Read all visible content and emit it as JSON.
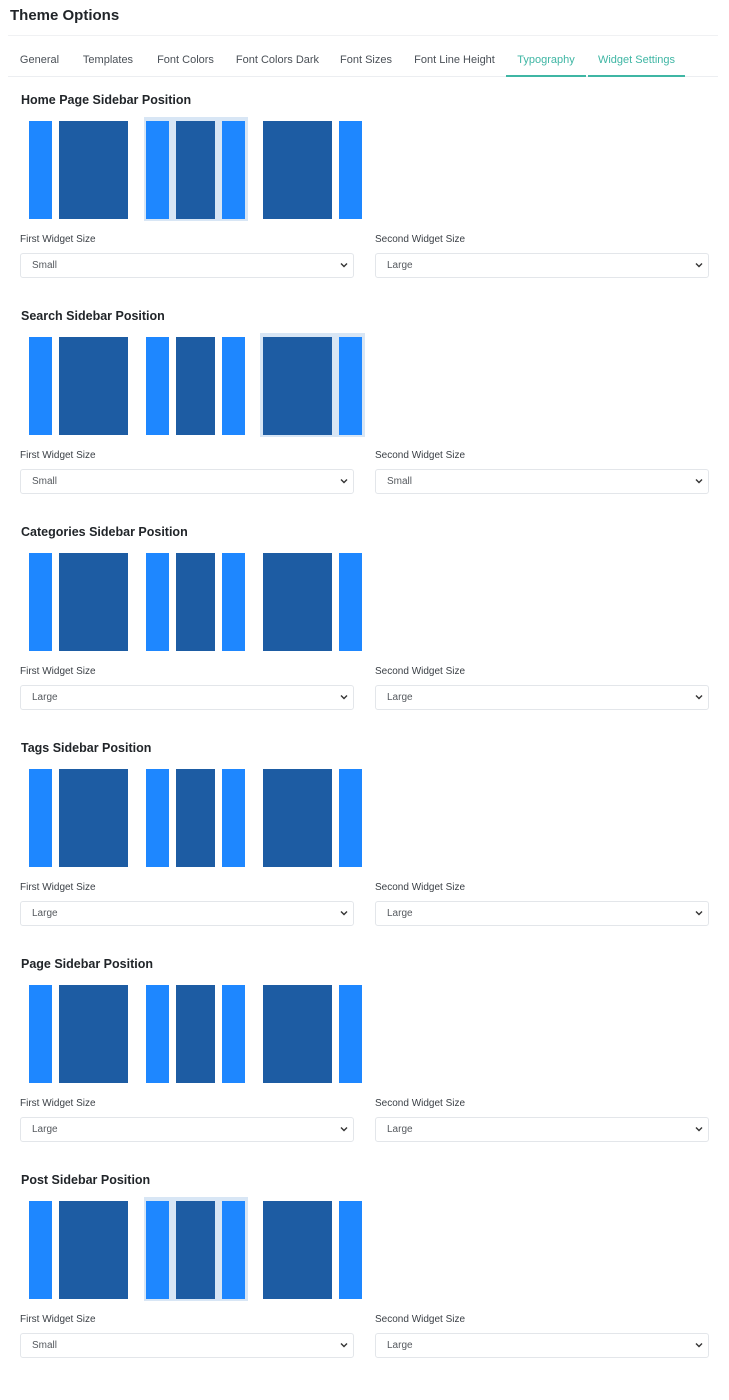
{
  "header": {
    "title": "Theme Options"
  },
  "tabs": [
    {
      "label": "General",
      "active": false
    },
    {
      "label": "Templates",
      "active": false
    },
    {
      "label": "Font Colors",
      "active": false
    },
    {
      "label": "Font Colors Dark",
      "active": false
    },
    {
      "label": "Font Sizes",
      "active": false
    },
    {
      "label": "Font Line Height",
      "active": false
    },
    {
      "label": "Typography",
      "active": true
    },
    {
      "label": "Widget Settings",
      "active": true
    }
  ],
  "colors": {
    "accent_tab": "#3fb6a4",
    "sidebar_block": "#1e87ff",
    "content_block": "#1d5ca3",
    "selected_bg": "#d8e6f5"
  },
  "sections": [
    {
      "title": "Home Page Sidebar Position",
      "selected": "both",
      "first_label": "First Widget Size",
      "first_value": "Small",
      "second_label": "Second Widget Size",
      "second_value": "Large"
    },
    {
      "title": "Search Sidebar Position",
      "selected": "right",
      "first_label": "First Widget Size",
      "first_value": "Small",
      "second_label": "Second Widget Size",
      "second_value": "Small"
    },
    {
      "title": "Categories Sidebar Position",
      "selected": "none",
      "first_label": "First Widget Size",
      "first_value": "Large",
      "second_label": "Second Widget Size",
      "second_value": "Large"
    },
    {
      "title": "Tags Sidebar Position",
      "selected": "none",
      "first_label": "First Widget Size",
      "first_value": "Large",
      "second_label": "Second Widget Size",
      "second_value": "Large"
    },
    {
      "title": "Page Sidebar Position",
      "selected": "none",
      "first_label": "First Widget Size",
      "first_value": "Large",
      "second_label": "Second Widget Size",
      "second_value": "Large"
    },
    {
      "title": "Post Sidebar Position",
      "selected": "both",
      "first_label": "First Widget Size",
      "first_value": "Small",
      "second_label": "Second Widget Size",
      "second_value": "Large"
    }
  ]
}
